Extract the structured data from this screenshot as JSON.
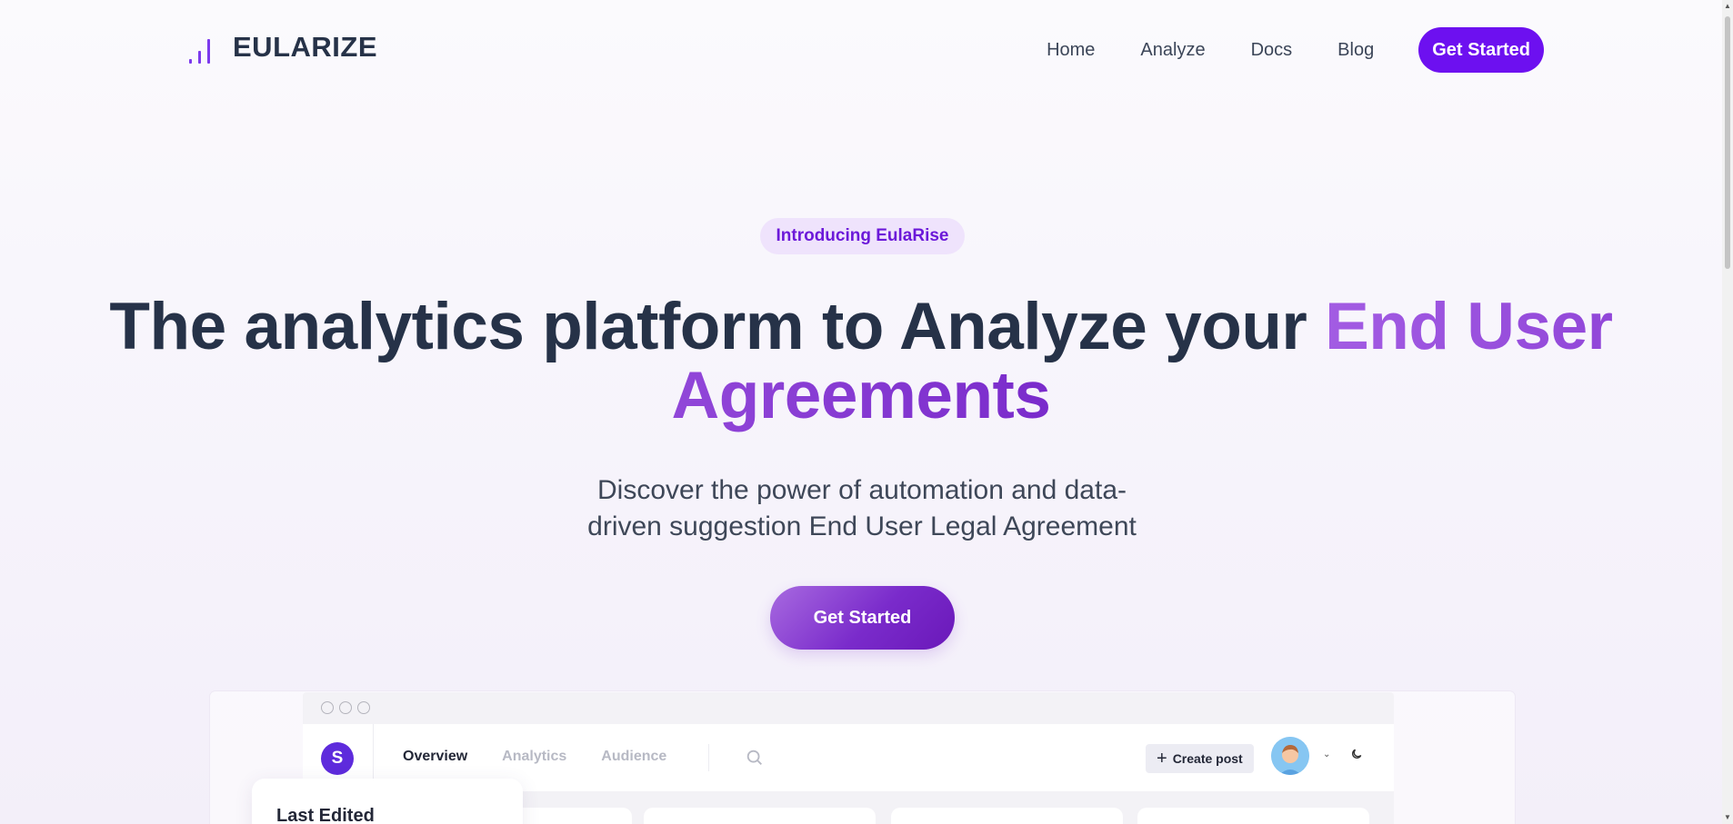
{
  "brand": {
    "name": "EULARIZE",
    "accent": "#6d10f0"
  },
  "nav": {
    "links": [
      "Home",
      "Analyze",
      "Docs",
      "Blog"
    ],
    "cta": "Get Started"
  },
  "hero": {
    "badge": "Introducing EulaRise",
    "headline_plain": "The analytics platform to Analyze your ",
    "headline_highlight": "End User Agreements",
    "subtitle": "Discover the power of automation and data-driven suggestion End User Legal Agreement",
    "cta": "Get Started"
  },
  "preview": {
    "avatar_initial": "S",
    "tabs": [
      "Overview",
      "Analytics",
      "Audience"
    ],
    "active_tab": "Overview",
    "create_post": "Create post",
    "last_edited": "Last Edited",
    "icons": [
      "search-icon",
      "chevron-down-icon",
      "moon-icon",
      "plus-icon"
    ]
  }
}
